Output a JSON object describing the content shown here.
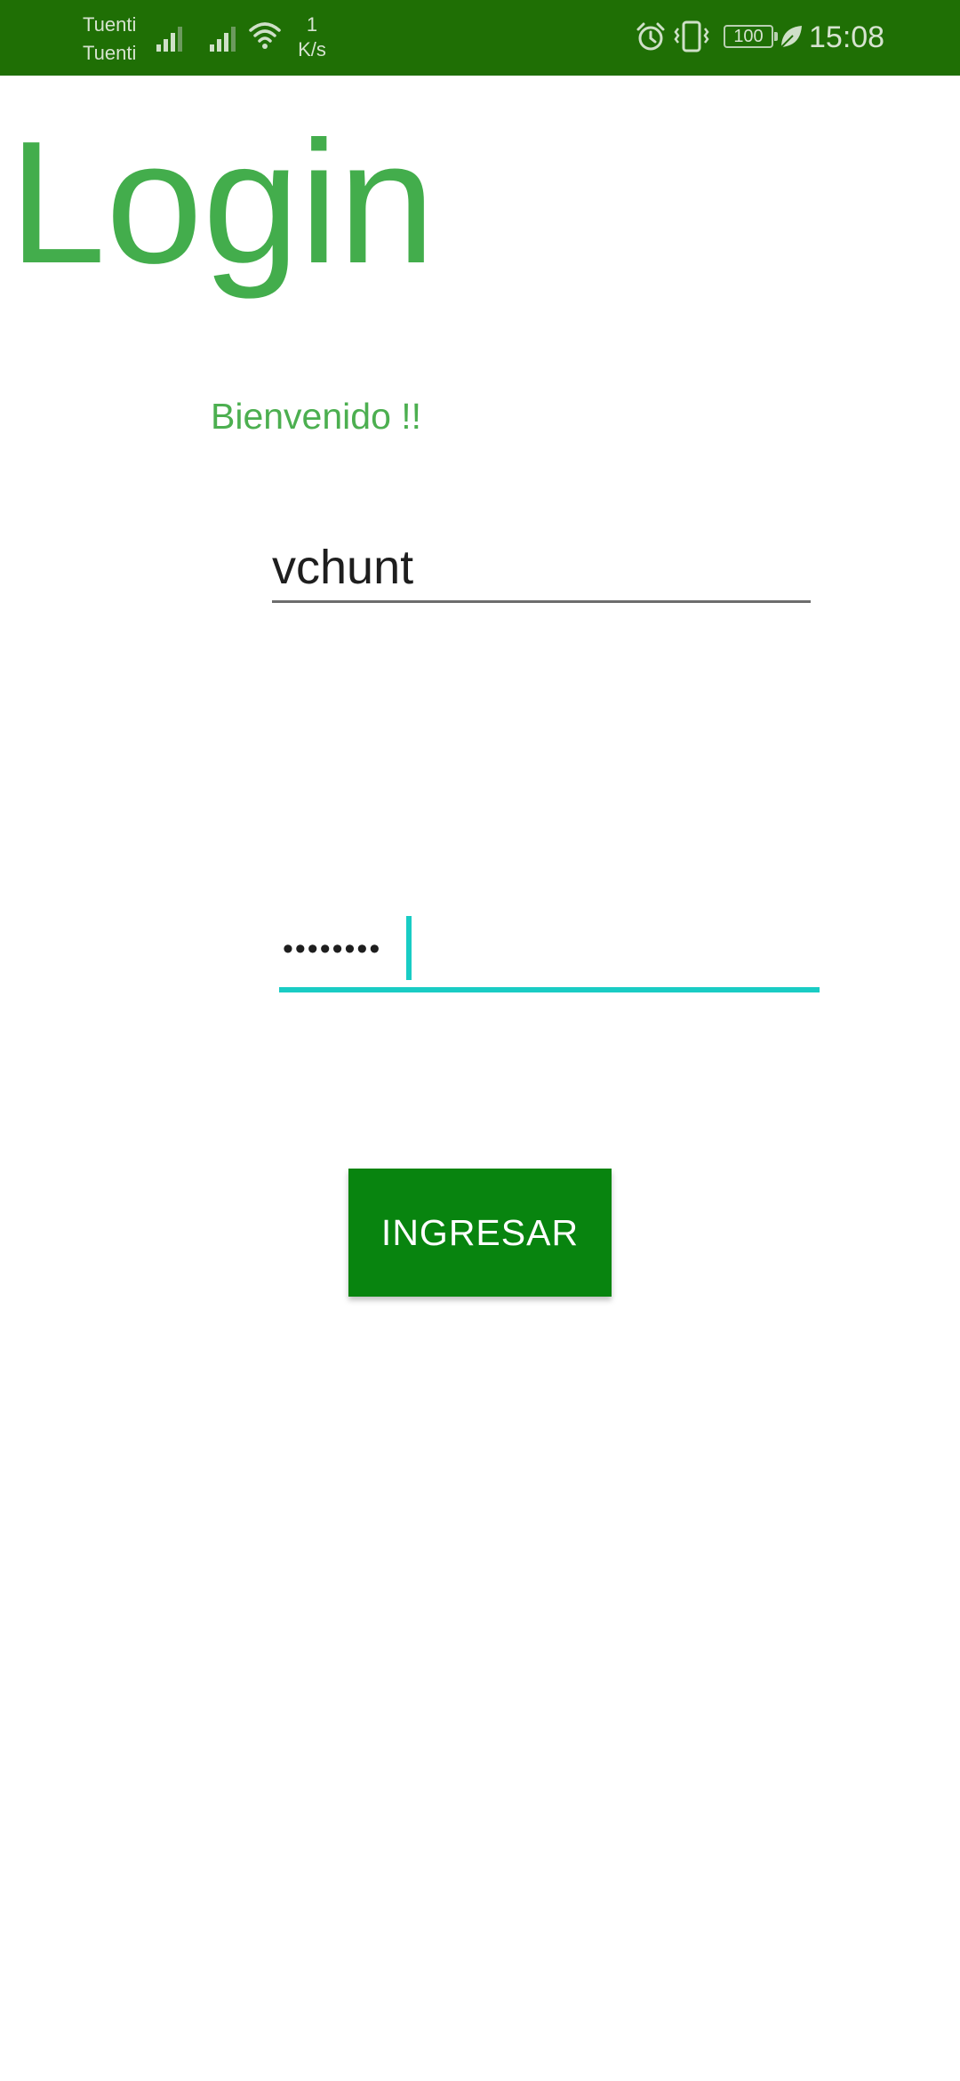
{
  "status_bar": {
    "carrier_1": "Tuenti",
    "carrier_2": "Tuenti",
    "net_speed_value": "1",
    "net_speed_unit": "K/s",
    "battery_level": "100",
    "time": "15:08",
    "icons": [
      "signal-icon",
      "signal-icon",
      "wifi-icon",
      "alarm-icon",
      "vibrate-icon",
      "battery-icon",
      "power-saver-leaf-icon"
    ],
    "background_color": "#1f6f05"
  },
  "page": {
    "title": "Login",
    "welcome_text": "Bienvenido !!",
    "title_color": "#43ad4c"
  },
  "form": {
    "username_value": "vchunt",
    "password_masked": "••••••••",
    "submit_label": "INGRESAR",
    "accent_color": "#19ccc4",
    "button_color": "#08840f"
  }
}
